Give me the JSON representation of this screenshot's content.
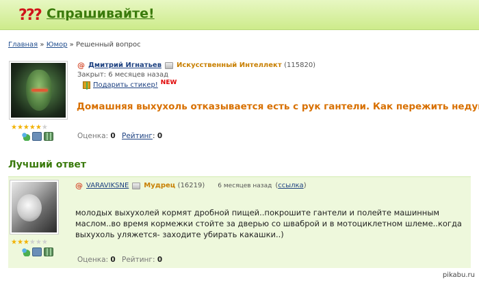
{
  "header": {
    "logo_marks": "???",
    "site_title": "Спрашивайте!"
  },
  "breadcrumb": {
    "home": "Главная",
    "sep1": " » ",
    "category": "Юмор",
    "sep2": " » ",
    "current": "Решенный вопрос"
  },
  "question": {
    "author": "Дмитрий Игнатьев",
    "rank": "Искусственный Интеллект",
    "rank_score": "(115820)",
    "closed": "Закрыт: 6 месяцев назад",
    "gift_link": "Подарить стикер!",
    "new_badge": "NEW",
    "text": "Домашняя выхухоль отказывается есть с рук гантели. Как пережить недуг ?)",
    "stars": "★★★★★★",
    "stars_on": 5,
    "score_label": "Оценка:",
    "score_value": "0",
    "rating_label": "Рейтинг",
    "rating_colon": ":",
    "rating_value": "0"
  },
  "best_answer": {
    "section_title": "Лучший ответ",
    "author": "VARAVIKSNE",
    "rank": "Мудрец",
    "rank_score": "(16219)",
    "date": "6 месяцев назад",
    "link_open": "(",
    "link_label": "ссылка",
    "link_close": ")",
    "text": "молодых выхухолей кормят дробной пищей..покрошите гантели и полейте машинным маслом..во время кормежки стойте за дверью со шваброй и в мотоциклетном шлеме..когда выхухоль уляжется- заходите убирать какашки..)",
    "stars": "★★★★★★",
    "stars_on": 3,
    "score_label": "Оценка:",
    "score_value": "0",
    "rating_label": "Рейтинг:",
    "rating_value": "0"
  },
  "watermark": "pikabu.ru",
  "colors": {
    "header_green": "#cdeb8b",
    "title_green": "#3a7a0c",
    "question_orange": "#d87000",
    "answer_bg": "#eef8dc",
    "link_blue": "#1c4080"
  },
  "icons": [
    "question-marks-icon",
    "at-icon",
    "mail-icon",
    "gift-icon",
    "user-icon",
    "camera-icon",
    "video-icon",
    "star-icon"
  ]
}
